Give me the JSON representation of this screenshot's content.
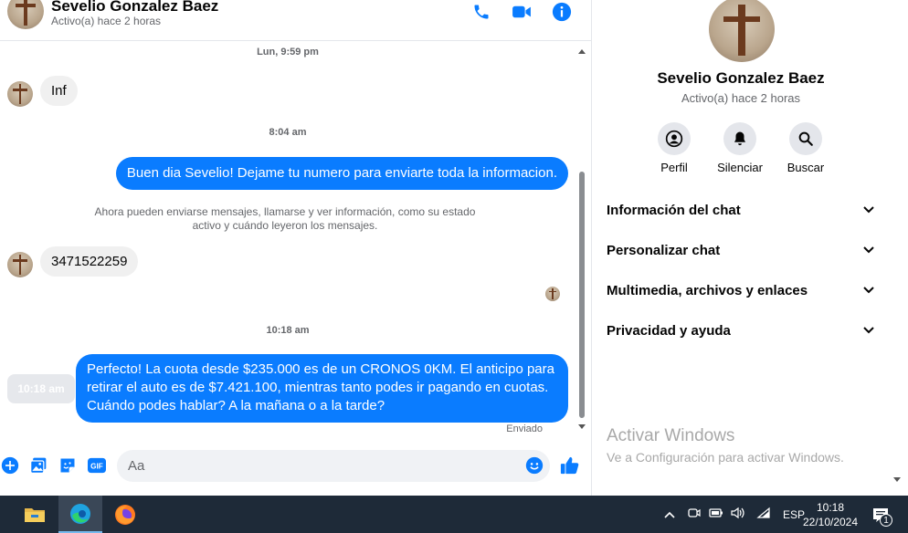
{
  "contact": {
    "name": "Sevelio Gonzalez Baez",
    "status": "Activo(a) hace 2 horas"
  },
  "header_icons": [
    "phone-icon",
    "video-icon",
    "info-icon"
  ],
  "messages": {
    "ts1": "Lun, 9:59 pm",
    "in1": "Inf",
    "ts2": "8:04 am",
    "out1": "Buen dia Sevelio! Dejame tu numero para enviarte toda la informacion.",
    "notice_line1": "Ahora pueden enviarse mensajes, llamarse y ver información, como su estado",
    "notice_line2": "activo y cuándo leyeron los mensajes.",
    "in2": "3471522259",
    "ts3": "10:18 am",
    "out2_line1": "Perfecto! La cuota desde $235.000 es de un CRONOS 0KM. El anticipo para",
    "out2_line2": "retirar el auto es de $7.421.100, mientras tanto podes ir pagando en cuotas.",
    "out2_line3": "Cuándo podes hablar? A la mañana o a la tarde?",
    "hover_time": "10:18 am",
    "sent_status": "Enviado"
  },
  "composer": {
    "placeholder": "Aa",
    "gif_label": "GIF"
  },
  "panel": {
    "actions": [
      {
        "label": "Perfil"
      },
      {
        "label": "Silenciar"
      },
      {
        "label": "Buscar"
      }
    ],
    "sections": [
      {
        "label": "Información del chat"
      },
      {
        "label": "Personalizar chat"
      },
      {
        "label": "Multimedia, archivos y enlaces"
      },
      {
        "label": "Privacidad y ayuda"
      }
    ],
    "watermark_title": "Activar Windows",
    "watermark_sub": "Ve a Configuración para activar Windows."
  },
  "taskbar": {
    "apps": [
      "file-explorer-icon",
      "edge-icon",
      "firefox-icon"
    ],
    "language": "ESP",
    "time": "10:18",
    "date": "22/10/2024",
    "notification_count": "1"
  },
  "colors": {
    "accent": "#0a7cff",
    "bubble_in": "#f0f0f0",
    "taskbar": "#1e2a38"
  }
}
